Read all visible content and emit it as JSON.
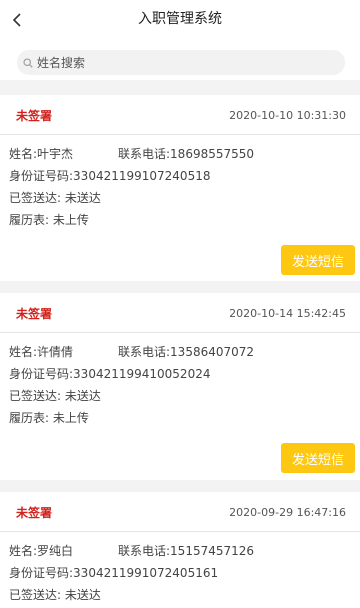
{
  "header": {
    "title": "入职管理系统",
    "back_icon": "chevron-left-icon"
  },
  "search": {
    "placeholder": "姓名搜索",
    "icon": "search-icon"
  },
  "records": [
    {
      "status": "未签署",
      "time": "2020-10-10 10:31:30",
      "name": "姓名:叶宇杰",
      "phone": "联系电话:18698557550",
      "id_number": "身份证号码:330421199107240518",
      "delivered": "已签送达:  未送达",
      "resume": "履历表:  未上传",
      "action": "发送短信"
    },
    {
      "status": "未签署",
      "time": "2020-10-14 15:42:45",
      "name": "姓名:许倩倩",
      "phone": "联系电话:13586407072",
      "id_number": "身份证号码:330421199410052024",
      "delivered": "已签送达:  未送达",
      "resume": "履历表:  未上传",
      "action": "发送短信"
    },
    {
      "status": "未签署",
      "time": "2020-09-29 16:47:16",
      "name": "姓名:罗纯白",
      "phone": "联系电话:15157457126",
      "id_number": "身份证号码:3304211991072405161",
      "delivered": "已签送达:  未送达"
    }
  ],
  "colors": {
    "status_red": "#d2211c",
    "button_yellow": "#fdc712",
    "background": "#f3f3f3"
  }
}
